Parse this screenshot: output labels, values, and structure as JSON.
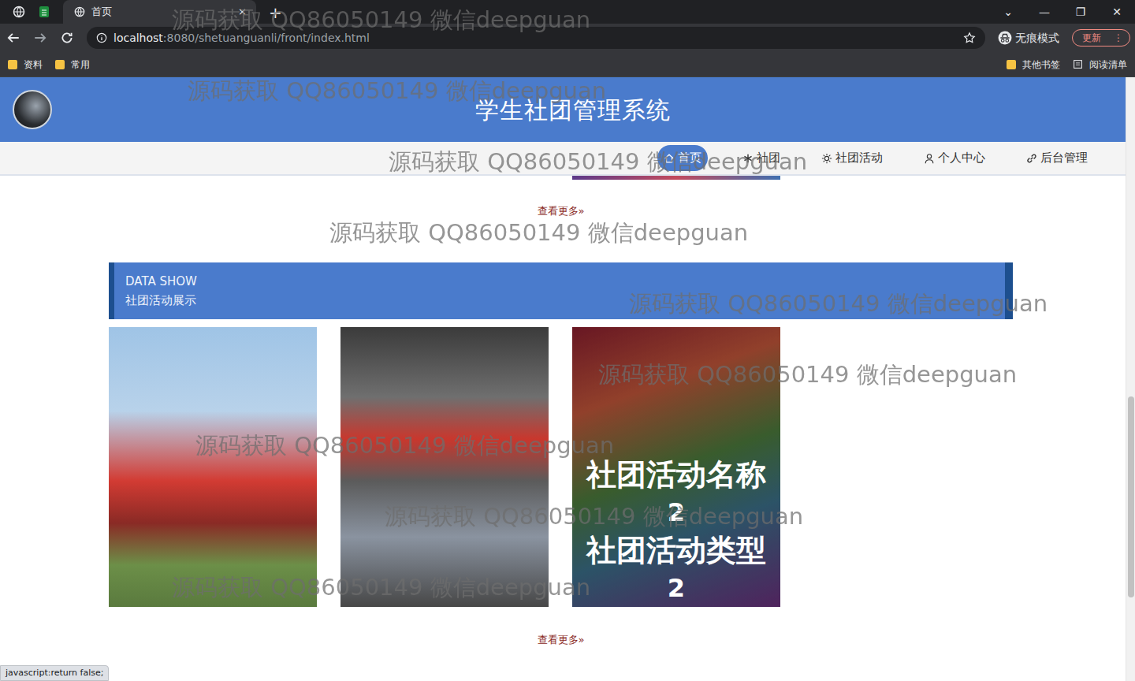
{
  "browser": {
    "tabs": [
      {
        "label": "首页",
        "selected": true,
        "close": "×"
      }
    ],
    "new_tab": "+",
    "window_controls": [
      "⌄",
      "—",
      "❐",
      "✕"
    ],
    "url": {
      "host": "localhost",
      "path": ":8080/shetuanguanli/front/index.html"
    },
    "profile": "无痕模式",
    "update": {
      "label": "更新",
      "menu": "⋮"
    },
    "bookmarks": [
      "资料",
      "常用"
    ],
    "bookmarks_right": [
      "其他书签",
      "阅读清单"
    ]
  },
  "header": {
    "title": "学生社团管理系统"
  },
  "nav": [
    {
      "label": "首页",
      "selected": true
    },
    {
      "label": "社团",
      "selected": false
    },
    {
      "label": "社团活动",
      "selected": false
    },
    {
      "label": "个人中心",
      "selected": false
    },
    {
      "label": "后台管理",
      "selected": false
    }
  ],
  "more_top": {
    "label": "查看更多",
    "arrow": "»"
  },
  "section": {
    "subtitle": "DATA SHOW",
    "title": "社团活动展示"
  },
  "cards": [
    {
      "hovered": false
    },
    {
      "hovered": false
    },
    {
      "hovered": true,
      "lines": [
        "社团活动名称",
        "2",
        "社团活动类型",
        "2"
      ]
    }
  ],
  "more_bottom": {
    "label": "查看更多",
    "arrow": "»"
  },
  "status_bar": "javascript:return false;",
  "watermarks": [
    "源码获取 QQ86050149 微信deepguan",
    "源码获取 QQ86050149 微信deepguan",
    "源码获取 QQ86050149 微信deepguan",
    "源码获取 QQ86050149 微信deepguan",
    "源码获取 QQ86050149 微信deepguan",
    "源码获取 QQ86050149 微信deepguan",
    "源码获取 QQ86050149 微信deepguan",
    "源码获取 QQ86050149 微信deepguan",
    "源码获取 QQ86050149 微信deepguan"
  ]
}
